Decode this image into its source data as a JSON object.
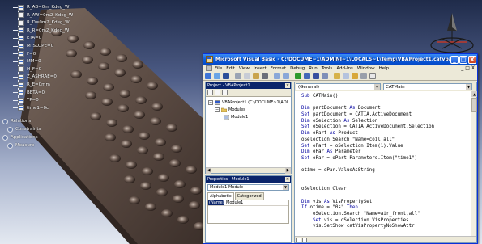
{
  "spec_tree": {
    "parameters": [
      "R_AB=0m_Kdeg_W",
      "R_AW=0m2_Kdeg_W",
      "R_D=0m2_Kdeg_W",
      "R_R=0m2_Kdeg_W",
      "ETA=0",
      "M_SLOPE=0",
      "F=0",
      "MM=0",
      "H_F=0",
      "Z_ASHRAE=0",
      "R_E=0mm",
      "BETA=0",
      "YP=0",
      "time1=0c"
    ],
    "relations": "Relations",
    "constraints": "Constraints",
    "applications": "Applications",
    "measure": "Measure"
  },
  "vba": {
    "title": "Microsoft Visual Basic - C:\\DOCUME~1\\ADMINI~1\\LOCALS~1\\Temp\\VBAProject1.catvba - [Module...",
    "title_buttons": [
      "_",
      "□",
      "X"
    ],
    "menu": [
      "File",
      "Edit",
      "View",
      "Insert",
      "Format",
      "Debug",
      "Run",
      "Tools",
      "Add-Ins",
      "Window",
      "Help"
    ],
    "mdi_buttons": [
      "_",
      "□",
      "X"
    ],
    "project_pane": {
      "title": "Project - VBAProject1",
      "project": "VBAProject1 (C:\\DOCUME~1\\ADI",
      "modules_folder": "Modules",
      "module": "Module1"
    },
    "properties_pane": {
      "title": "Properties - Module1",
      "object": "Module1 Module",
      "tabs": [
        "Alphabetic",
        "Categorized"
      ],
      "rows": [
        {
          "name": "(Name)",
          "value": "Module1"
        }
      ]
    },
    "code_pane": {
      "object_combo": "(General)",
      "proc_combo": "CATMain",
      "lines": [
        "Sub CATMain()",
        "",
        "Dim partDocument As Document",
        "Set partDocument = CATIA.ActiveDocument",
        "Dim oSelection As Selection",
        "Set oSelection = CATIA.ActiveDocument.Selection",
        "Dim oPart As Product",
        "oSelection.Search \"Name=coil,all\"",
        "Set oPart = oSelection.Item(1).Value",
        "Dim oPar As Parameter",
        "Set oPar = oPart.Parameters.Item(\"time1\")",
        "",
        "otime = oPar.ValueAsString",
        "",
        "",
        "oSelection.Clear",
        "",
        "Dim vis As VisPropertySet",
        "If otime = \"0s\" Then",
        "    oSelection.Search \"Name=air_front,all\"",
        "    Set vis = oSelection.VisProperties",
        "    vis.SetShow catVisPropertyNoShowAttr"
      ]
    }
  },
  "colors": {
    "xp_blue": "#0a5ee0",
    "vba_keyword": "#0000a0",
    "model_surface": "#5a4b44"
  }
}
